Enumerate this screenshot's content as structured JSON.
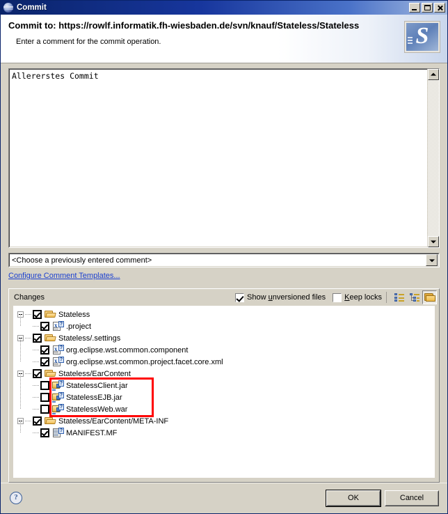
{
  "window": {
    "title": "Commit",
    "icon": "svn-globe-icon",
    "controls": {
      "minimize": "Minimize",
      "maximize": "Maximize",
      "close": "Close"
    }
  },
  "header": {
    "title": "Commit to: https://rowlf.informatik.fh-wiesbaden.de/svn/knauf/Stateless/Stateless",
    "subtitle": "Enter a comment for the commit operation.",
    "logo": "subversion-logo"
  },
  "comment": {
    "value": "Allererstes Commit",
    "placeholder": ""
  },
  "history_combo": {
    "value": "<Choose a previously entered comment>"
  },
  "templates_link": {
    "label": "Configure Comment Templates..."
  },
  "changes": {
    "group_label": "Changes",
    "show_unversioned": {
      "label_pre": "Show ",
      "label_mnemonic": "u",
      "label_post": "nversioned files",
      "label": "Show unversioned files",
      "checked": true
    },
    "keep_locks": {
      "label_pre": "",
      "label_mnemonic": "K",
      "label_post": "eep locks",
      "label": "Keep locks",
      "checked": false
    },
    "toolbar": [
      {
        "name": "flat-layout-icon",
        "pressed": false
      },
      {
        "name": "tree-layout-icon",
        "pressed": false
      },
      {
        "name": "compressed-folders-icon",
        "pressed": true
      }
    ],
    "tree": [
      {
        "level": 0,
        "expander": true,
        "checked": true,
        "icon": "folder-icon",
        "label": "Stateless"
      },
      {
        "level": 1,
        "expander": false,
        "checked": true,
        "icon": "xml-file-icon",
        "label": ".project"
      },
      {
        "level": 0,
        "expander": true,
        "checked": true,
        "icon": "folder-icon",
        "label": "Stateless/.settings"
      },
      {
        "level": 1,
        "expander": false,
        "checked": true,
        "icon": "xml-file-icon",
        "label": "org.eclipse.wst.common.component"
      },
      {
        "level": 1,
        "expander": false,
        "checked": true,
        "icon": "xml-file-icon",
        "label": "org.eclipse.wst.common.project.facet.core.xml"
      },
      {
        "level": 0,
        "expander": true,
        "checked": true,
        "icon": "folder-icon",
        "label": "Stateless/EarContent"
      },
      {
        "level": 1,
        "expander": false,
        "checked": false,
        "icon": "jar-file-icon",
        "label": "StatelessClient.jar"
      },
      {
        "level": 1,
        "expander": false,
        "checked": false,
        "icon": "jar-file-icon",
        "label": "StatelessEJB.jar"
      },
      {
        "level": 1,
        "expander": false,
        "checked": false,
        "icon": "jar-file-icon",
        "label": "StatelessWeb.war"
      },
      {
        "level": 0,
        "expander": true,
        "checked": true,
        "icon": "folder-icon",
        "label": "Stateless/EarContent/META-INF"
      },
      {
        "level": 1,
        "expander": false,
        "checked": true,
        "icon": "manifest-file-icon",
        "label": "MANIFEST.MF"
      }
    ],
    "annotation": {
      "color": "#ff0000",
      "first_row_index": 6,
      "row_count": 3
    }
  },
  "footer": {
    "help": "?",
    "ok_label": "OK",
    "cancel_label": "Cancel"
  },
  "colors": {
    "title_bar_start": "#0a246a",
    "title_bar_end": "#a6bce0",
    "dialog_face": "#d6d2c6",
    "link": "#1a3fd0",
    "annotation": "#ff0000"
  }
}
